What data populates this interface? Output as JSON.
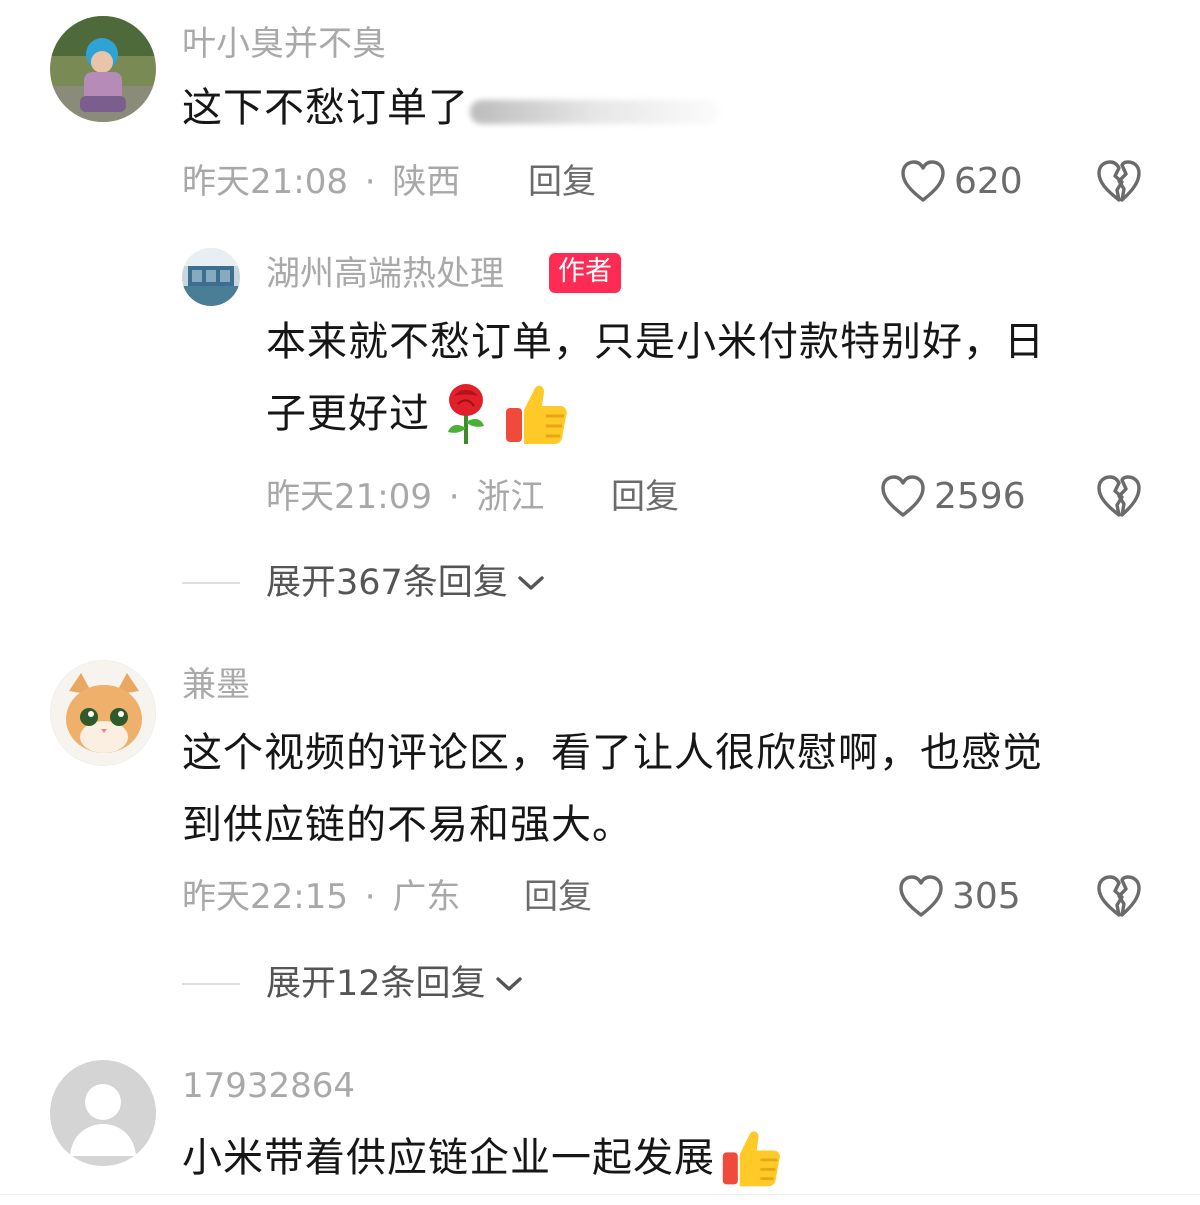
{
  "comments": [
    {
      "username": "叶小臭并不臭",
      "content": "这下不愁订单了",
      "timestamp": "昨天21:08",
      "location": "陕西",
      "reply_label": "回复",
      "likes": "620"
    },
    {
      "username": "湖州高端热处理",
      "badge": "作者",
      "content_line1": "本来就不愁订单，只是小米付款特别好，日",
      "content_line2": "子更好过",
      "timestamp": "昨天21:09",
      "location": "浙江",
      "reply_label": "回复",
      "likes": "2596"
    },
    {
      "username": "兼墨",
      "content_line1": "这个视频的评论区，看了让人很欣慰啊，也感觉",
      "content_line2": "到供应链的不易和强大。",
      "timestamp": "昨天22:15",
      "location": "广东",
      "reply_label": "回复",
      "likes": "305"
    },
    {
      "username": "17932864",
      "content": "小米带着供应链企业一起发展"
    }
  ],
  "expand": [
    {
      "label": "展开367条回复"
    },
    {
      "label": "展开12条回复"
    }
  ],
  "separator": "·",
  "icons": {
    "like": "heart-outline-icon",
    "dislike": "broken-heart-icon",
    "expand": "chevron-down-icon",
    "rose": "rose-emoji",
    "thumbs_up": "thumbs-up-emoji"
  },
  "colors": {
    "author_badge": "#fe2c55",
    "username": "#a9a9a9",
    "meta": "#a8a8a8",
    "action": "#6b6b6b"
  }
}
